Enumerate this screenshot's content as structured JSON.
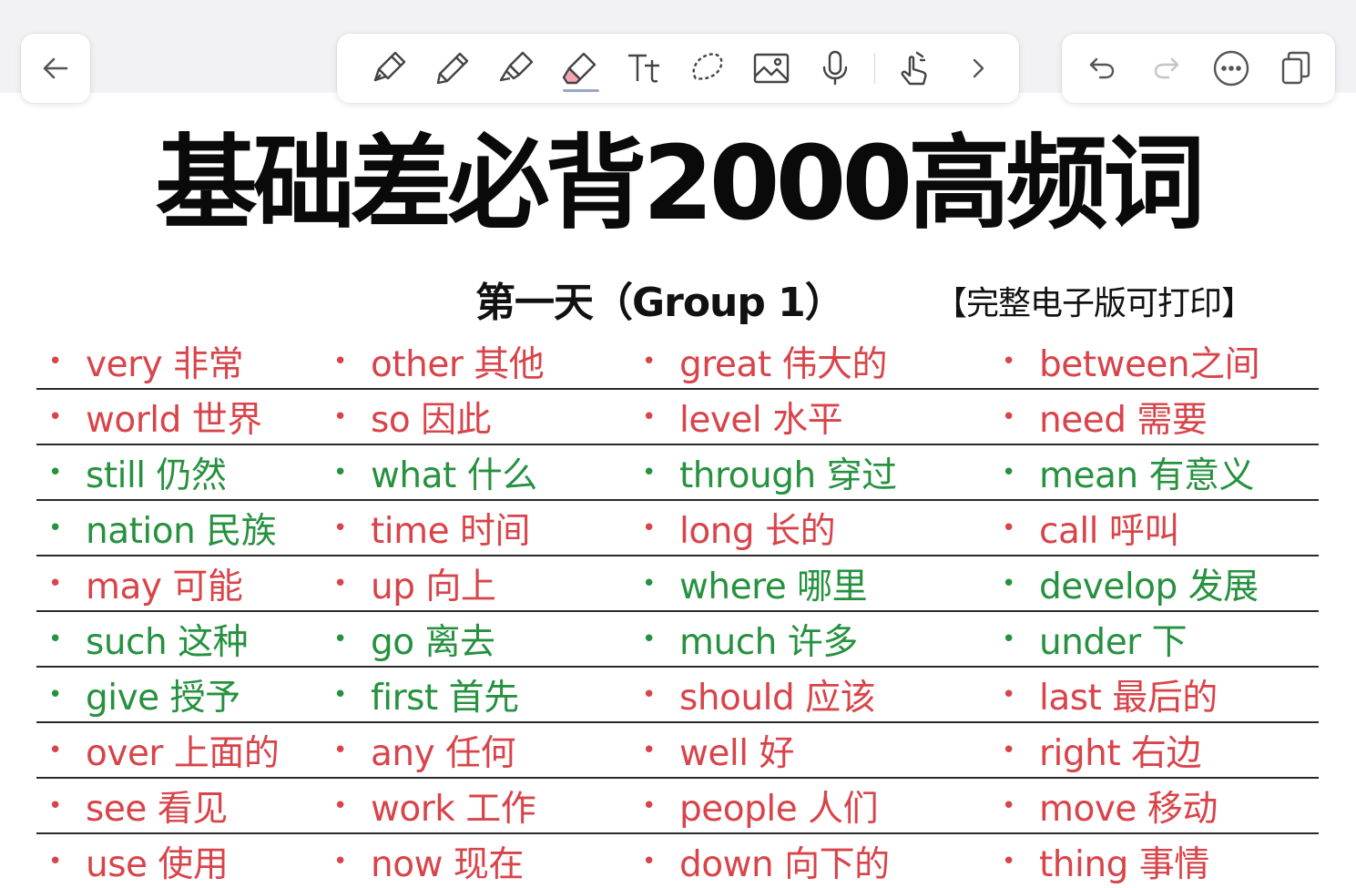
{
  "colors": {
    "red": "#d8444a",
    "green": "#26913f"
  },
  "toolbar": {
    "back_icon": "arrow-left-icon",
    "tools": [
      "fountain-pen-icon",
      "pencil-icon",
      "highlighter-icon",
      "eraser-icon",
      "text-tool-icon",
      "lasso-icon",
      "image-icon",
      "microphone-icon",
      "finger-touch-icon",
      "chevron-right-icon"
    ],
    "active_tool": "eraser-icon",
    "right_icons": [
      "undo-icon",
      "redo-icon",
      "more-icon",
      "pages-icon"
    ]
  },
  "document": {
    "title": "基础差必背2000高频词",
    "subtitle": "第一天（Group 1）",
    "print_note": "【完整电子版可打印】",
    "bullet": "•",
    "rows": [
      [
        {
          "text": "very 非常",
          "color": "red"
        },
        {
          "text": "other 其他",
          "color": "red"
        },
        {
          "text": "great 伟大的",
          "color": "red"
        },
        {
          "text": "between之间",
          "color": "red"
        }
      ],
      [
        {
          "text": "world 世界",
          "color": "red"
        },
        {
          "text": "so 因此",
          "color": "red"
        },
        {
          "text": "level 水平",
          "color": "red"
        },
        {
          "text": "need 需要",
          "color": "red"
        }
      ],
      [
        {
          "text": "still 仍然",
          "color": "green"
        },
        {
          "text": "what 什么",
          "color": "green"
        },
        {
          "text": "through 穿过",
          "color": "green"
        },
        {
          "text": "mean 有意义",
          "color": "green"
        }
      ],
      [
        {
          "text": "nation 民族",
          "color": "green"
        },
        {
          "text": "time 时间",
          "color": "red"
        },
        {
          "text": "long 长的",
          "color": "red"
        },
        {
          "text": "call 呼叫",
          "color": "red"
        }
      ],
      [
        {
          "text": "may 可能",
          "color": "red"
        },
        {
          "text": "up 向上",
          "color": "red"
        },
        {
          "text": "where 哪里",
          "color": "green"
        },
        {
          "text": "develop 发展",
          "color": "green"
        }
      ],
      [
        {
          "text": "such 这种",
          "color": "green"
        },
        {
          "text": "go 离去",
          "color": "green"
        },
        {
          "text": "much 许多",
          "color": "green"
        },
        {
          "text": "under 下",
          "color": "green"
        }
      ],
      [
        {
          "text": "give 授予",
          "color": "green"
        },
        {
          "text": "first 首先",
          "color": "green"
        },
        {
          "text": "should 应该",
          "color": "red"
        },
        {
          "text": "last 最后的",
          "color": "red"
        }
      ],
      [
        {
          "text": "over 上面的",
          "color": "red"
        },
        {
          "text": "any 任何",
          "color": "red"
        },
        {
          "text": "well 好",
          "color": "red"
        },
        {
          "text": "right 右边",
          "color": "red"
        }
      ],
      [
        {
          "text": "see 看见",
          "color": "red"
        },
        {
          "text": "work 工作",
          "color": "red"
        },
        {
          "text": "people 人们",
          "color": "red"
        },
        {
          "text": "move 移动",
          "color": "red"
        }
      ],
      [
        {
          "text": "use 使用",
          "color": "red"
        },
        {
          "text": "now 现在",
          "color": "red"
        },
        {
          "text": "down 向下的",
          "color": "red"
        },
        {
          "text": "thing 事情",
          "color": "red"
        }
      ]
    ]
  }
}
